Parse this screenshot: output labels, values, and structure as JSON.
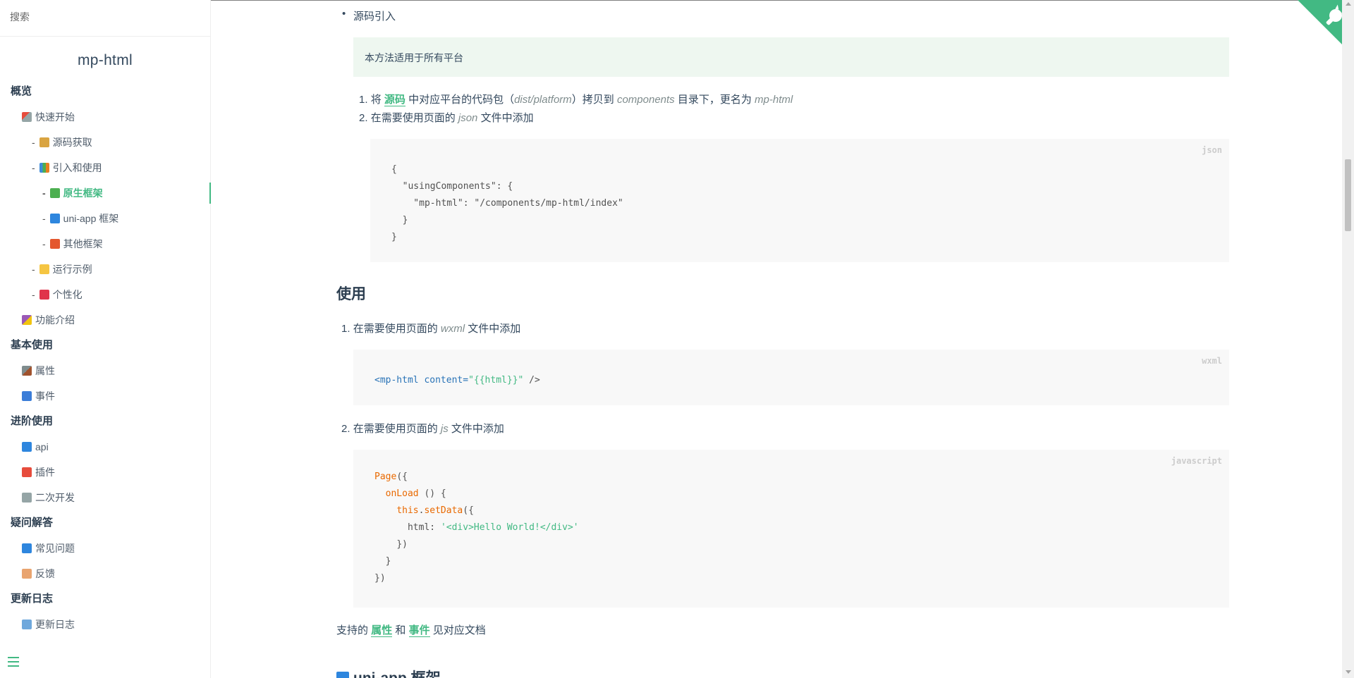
{
  "sidebar": {
    "search_placeholder": "搜索",
    "app_name": "mp-html",
    "sections": [
      {
        "title": "概览",
        "items": [
          {
            "label": "快速开始",
            "icon": "rocket-icon",
            "level": 1
          },
          {
            "label": "源码获取",
            "icon": "package-icon",
            "level": 2
          },
          {
            "label": "引入和使用",
            "icon": "books-icon",
            "level": 2
          },
          {
            "label": "原生框架",
            "icon": "green-book-icon",
            "level": 3,
            "active": true
          },
          {
            "label": "uni-app 框架",
            "icon": "blue-book-icon",
            "level": 3
          },
          {
            "label": "其他框架",
            "icon": "orange-book-icon",
            "level": 3
          },
          {
            "label": "运行示例",
            "icon": "bulb-icon",
            "level": 2
          },
          {
            "label": "个性化",
            "icon": "pin-icon",
            "level": 2
          },
          {
            "label": "功能介绍",
            "icon": "party-icon",
            "level": 1
          }
        ]
      },
      {
        "title": "基本使用",
        "items": [
          {
            "label": "属性",
            "icon": "hammer-icon",
            "level": 1
          },
          {
            "label": "事件",
            "icon": "mailbox-icon",
            "level": 1
          }
        ]
      },
      {
        "title": "进阶使用",
        "items": [
          {
            "label": "api",
            "icon": "magnifier-icon",
            "level": 1
          },
          {
            "label": "插件",
            "icon": "pushpin-icon",
            "level": 1
          },
          {
            "label": "二次开发",
            "icon": "wrench-icon",
            "level": 1
          }
        ]
      },
      {
        "title": "疑问解答",
        "items": [
          {
            "label": "常见问题",
            "icon": "book-icon",
            "level": 1
          },
          {
            "label": "反馈",
            "icon": "envelope-icon",
            "level": 1
          }
        ]
      },
      {
        "title": "更新日志",
        "items": [
          {
            "label": "更新日志",
            "icon": "open-book-icon",
            "level": 1
          }
        ]
      }
    ]
  },
  "content": {
    "bullet": "源码引入",
    "tip": "本方法适用于所有平台",
    "step1": {
      "num": "1.",
      "pre": "将",
      "link": "源码",
      "mid": "中对应平台的代码包（",
      "path": "dist/platform",
      "mid2": "）拷贝到",
      "dir": "components",
      "mid3": "目录下，更名为",
      "name": "mp-html"
    },
    "step2": {
      "num": "2.",
      "pre": "在需要使用页面的",
      "file": "json",
      "post": "文件中添加"
    },
    "json_code": {
      "lang": "json",
      "lines": [
        "{",
        "  \"usingComponents\": {",
        "    \"mp-html\": \"/components/mp-html/index\"",
        "  }",
        "}"
      ]
    },
    "h2_use": "使用",
    "use1": {
      "num": "1.",
      "pre": "在需要使用页面的",
      "file": "wxml",
      "post": "文件中添加"
    },
    "wxml_code": {
      "lang": "wxml",
      "tag_open": "<mp-html",
      "attr": "content=",
      "val": "\"{{html}}\"",
      "tag_close": " />"
    },
    "use2": {
      "num": "2.",
      "pre": "在需要使用页面的",
      "file": "js",
      "post": "文件中添加"
    },
    "js_code": {
      "lang": "javascript",
      "l1_fn": "Page",
      "l1_rest": "({",
      "l2_fn": "onLoad",
      "l2_rest": " () {",
      "l3_this": "this",
      "l3_dot": ".",
      "l3_fn": "setData",
      "l3_rest": "({",
      "l4_key": "html: ",
      "l4_str": "'<div>Hello World!</div>'",
      "l5": "})",
      "l6": "}",
      "l7": "})"
    },
    "support": {
      "pre": "支持的",
      "link1": "属性",
      "and": "和",
      "link2": "事件",
      "post": "见对应文档"
    },
    "h2_next": "uni-app 框架"
  },
  "colors": {
    "accent": "#42b983",
    "text": "#34495e",
    "code_bg": "#f8f8f8",
    "tip_bg": "#eef7f0"
  }
}
